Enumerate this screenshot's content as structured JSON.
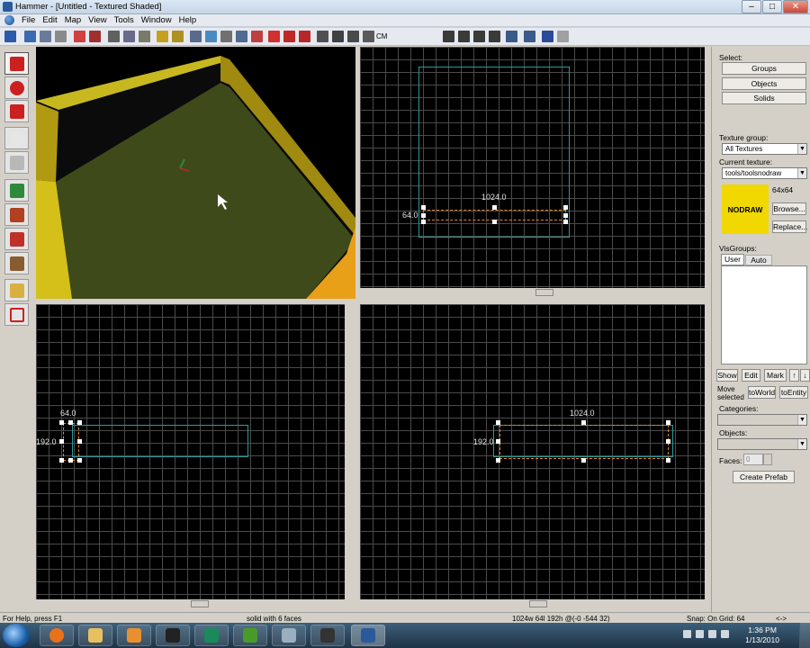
{
  "window": {
    "title": "Hammer - [Untitled - Textured Shaded]",
    "minimize": "–",
    "maximize": "□",
    "close": "✕"
  },
  "menu": [
    "File",
    "Edit",
    "Map",
    "View",
    "Tools",
    "Window",
    "Help"
  ],
  "toolbar": {
    "cm_label": "CM"
  },
  "left_tools": [
    {
      "name": "selection-tool",
      "color": "#cc2020"
    },
    {
      "name": "magnify-tool",
      "color": "#cc2020"
    },
    {
      "name": "camera-tool",
      "color": "#cc2020"
    },
    {
      "name": "entity-tool",
      "color": "#e0e0e0"
    },
    {
      "name": "block-tool",
      "color": "#b0b0b0"
    },
    {
      "name": "texture-application-tool",
      "color": "#2e8a3a"
    },
    {
      "name": "apply-current-texture-tool",
      "color": "#b04020"
    },
    {
      "name": "decal-tool",
      "color": "#c0302a"
    },
    {
      "name": "overlay-tool",
      "color": "#8a5a30"
    },
    {
      "name": "clipping-tool",
      "color": "#d8b040"
    },
    {
      "name": "vertex-tool",
      "color": "#cc2020"
    }
  ],
  "viewports": {
    "top_right": {
      "width_label": "1024.0",
      "height_label": "64.0"
    },
    "bottom_left": {
      "width_label": "64.0",
      "height_label": "192.0"
    },
    "bottom_right": {
      "width_label": "1024.0",
      "height_label": "192.0"
    }
  },
  "right_panel": {
    "select_label": "Select:",
    "select_buttons": [
      "Groups",
      "Objects",
      "Solids"
    ],
    "texture_group_label": "Texture group:",
    "texture_group_value": "All Textures",
    "current_texture_label": "Current texture:",
    "current_texture_value": "tools/toolsnodraw",
    "texture_size": "64x64",
    "texture_preview_text": "NODRAW",
    "browse_label": "Browse...",
    "replace_label": "Replace...",
    "visgroups_label": "VisGroups:",
    "visgroup_tabs": [
      "User",
      "Auto"
    ],
    "show_label": "Show",
    "edit_label": "Edit",
    "mark_label": "Mark",
    "up_arrow": "↑",
    "down_arrow": "↓",
    "move_selected_label": "Move selected",
    "to_world_label": "toWorld",
    "to_entity_label": "toEntity",
    "categories_label": "Categories:",
    "objects_label": "Objects:",
    "faces_label": "Faces:",
    "faces_value": "0",
    "create_prefab_label": "Create Prefab"
  },
  "status": {
    "help": "For Help, press F1",
    "selection": "solid with 6 faces",
    "dimensions": "1024w 64l 192h @(-0 -544 32)",
    "snap": "Snap: On Grid: 64",
    "extra": "<->"
  },
  "taskbar": {
    "time": "1:36 PM",
    "date": "1/13/2010"
  }
}
